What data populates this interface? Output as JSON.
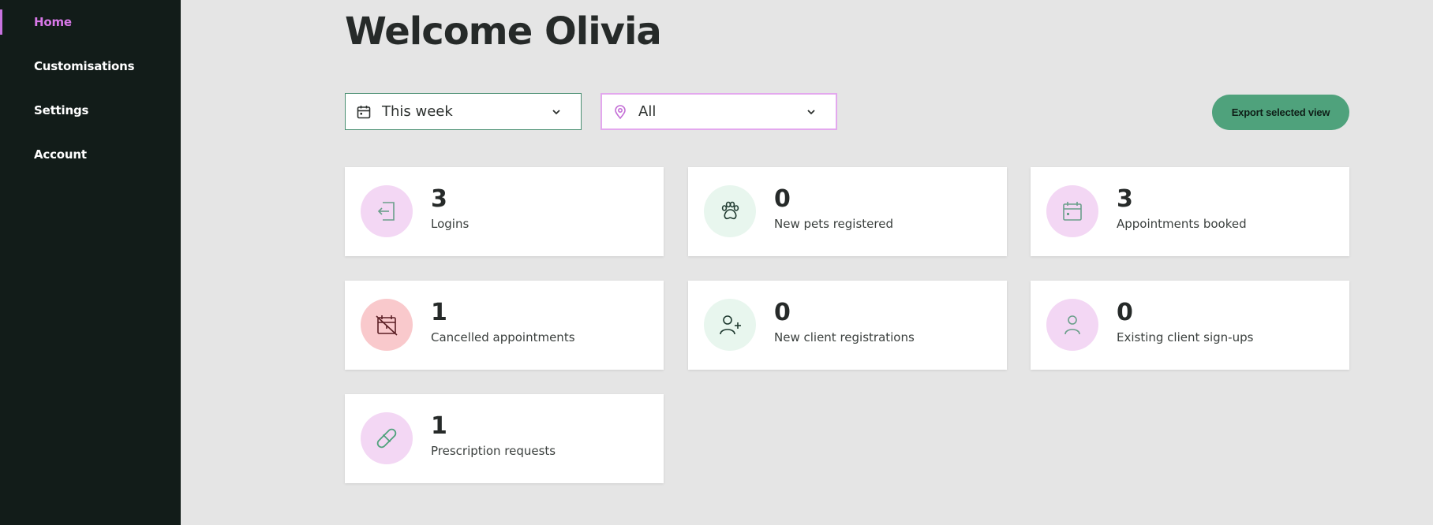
{
  "nav": {
    "items": [
      {
        "label": "Home",
        "active": true
      },
      {
        "label": "Customisations"
      },
      {
        "label": "Settings"
      },
      {
        "label": "Account"
      }
    ]
  },
  "header": {
    "title": "Welcome Olivia"
  },
  "filters": {
    "date": {
      "value": "This week",
      "icon": "calendar-icon"
    },
    "location": {
      "value": "All",
      "icon": "location-pin-icon"
    }
  },
  "actions": {
    "export_label": "Export selected view"
  },
  "stats": [
    {
      "value": "3",
      "label": "Logins",
      "icon": "login-icon",
      "tone": "pink"
    },
    {
      "value": "0",
      "label": "New pets registered",
      "icon": "paw-icon",
      "tone": "green"
    },
    {
      "value": "3",
      "label": "Appointments booked",
      "icon": "calendar-icon",
      "tone": "pink"
    },
    {
      "value": "1",
      "label": "Cancelled appointments",
      "icon": "calendar-cancelled-icon",
      "tone": "red"
    },
    {
      "value": "0",
      "label": "New client registrations",
      "icon": "add-user-icon",
      "tone": "green"
    },
    {
      "value": "0",
      "label": "Existing client sign-ups",
      "icon": "user-icon",
      "tone": "pink"
    },
    {
      "value": "1",
      "label": "Prescription requests",
      "icon": "pill-icon",
      "tone": "pink"
    }
  ],
  "colors": {
    "sidebar_bg": "#121c19",
    "active_nav": "#d878e8",
    "page_bg": "#e5e5e5",
    "accent_green": "#4fa27c",
    "pink_circle": "#f3d7f4",
    "green_circle": "#e8f6ee",
    "red_circle": "#f9c9cc"
  }
}
